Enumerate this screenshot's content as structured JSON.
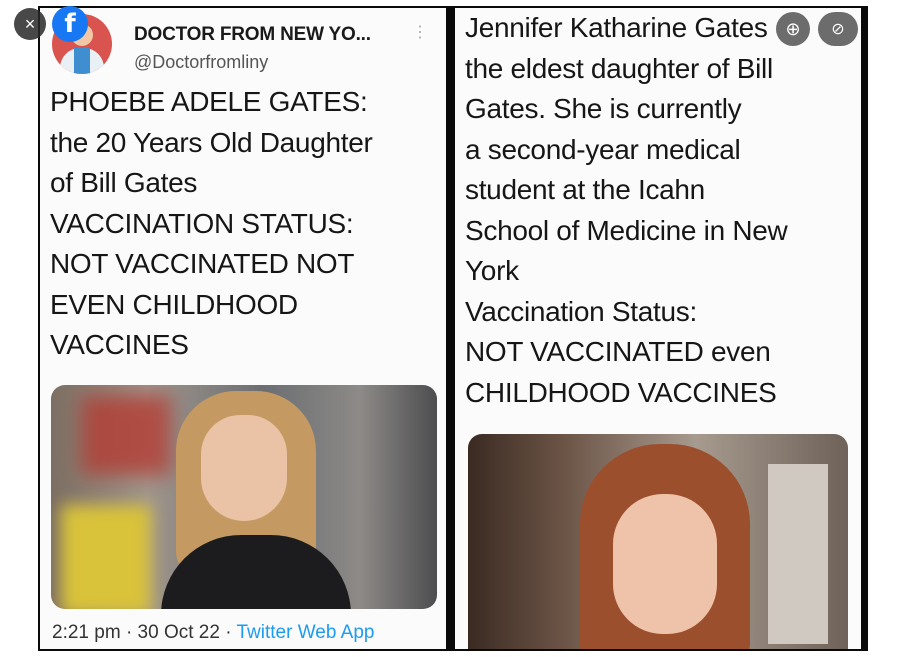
{
  "viewer": {
    "close_icon": "×",
    "facebook_logo": "f",
    "zoom_icon": "⊕",
    "tag_icon": "⊘",
    "expand_icon": "⤢"
  },
  "left_tweet": {
    "display_name": "DOCTOR FROM NEW YO...",
    "more_icon": "⋮",
    "handle": "@Doctorfromliny",
    "lines": [
      "PHOEBE ADELE GATES:",
      "the 20 Years Old Daughter",
      "of Bill Gates",
      "VACCINATION STATUS:",
      "NOT VACCINATED NOT",
      "EVEN CHILDHOOD",
      "VACCINES"
    ],
    "time": "2:21 pm",
    "date": "30 Oct 22",
    "app": "Twitter Web App"
  },
  "right_card": {
    "lines": [
      "Jennifer Katharine Gates",
      "the eldest daughter of Bill",
      "Gates. She is currently",
      "a second-year medical",
      "student at the Icahn",
      "School of Medicine in New",
      "York",
      "Vaccination Status:",
      "NOT VACCINATED even",
      "CHILDHOOD VACCINES"
    ]
  },
  "colors": {
    "link_blue": "#1d9bf0",
    "facebook_blue": "#1877f2"
  }
}
